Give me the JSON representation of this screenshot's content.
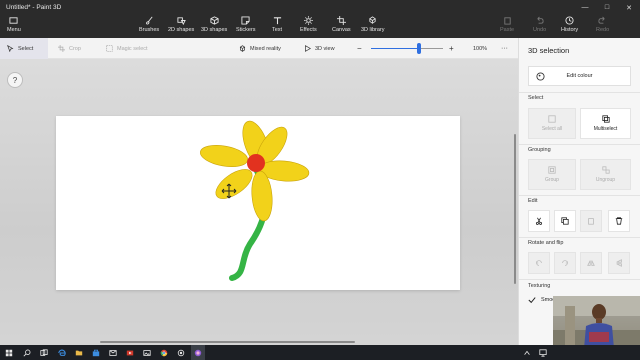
{
  "window": {
    "title": "Untitled* - Paint 3D"
  },
  "ribbon": {
    "menu": "Menu",
    "tools": [
      "Brushes",
      "2D shapes",
      "3D shapes",
      "Stickers",
      "Text",
      "Effects",
      "Canvas",
      "3D library"
    ],
    "right": [
      "Paste",
      "Undo",
      "History",
      "Redo"
    ]
  },
  "toolbar": {
    "select": "Select",
    "crop": "Crop",
    "magic_select": "Magic select",
    "mixed_reality": "Mixed reality",
    "view_3d": "3D view",
    "zoom_minus": "−",
    "zoom_plus": "+",
    "zoom": "100%",
    "zoom_level": 0.67,
    "more": "···"
  },
  "workspace": {
    "help": "?"
  },
  "panel": {
    "title": "3D selection",
    "edit_colour": "Edit colour",
    "select_section": "Select",
    "select_all": "Select all",
    "multiselect": "Multiselect",
    "grouping_section": "Grouping",
    "group": "Group",
    "ungroup": "Ungroup",
    "edit_section": "Edit",
    "rotate_flip_section": "Rotate and flip",
    "texturing_section": "Texturing",
    "smooth": "Smoo"
  },
  "colors": {
    "petal": "#f2d21a",
    "petal_edge": "#c9a30b",
    "center": "#e2321f",
    "stem": "#35b445",
    "accent": "#2f6fe0"
  }
}
